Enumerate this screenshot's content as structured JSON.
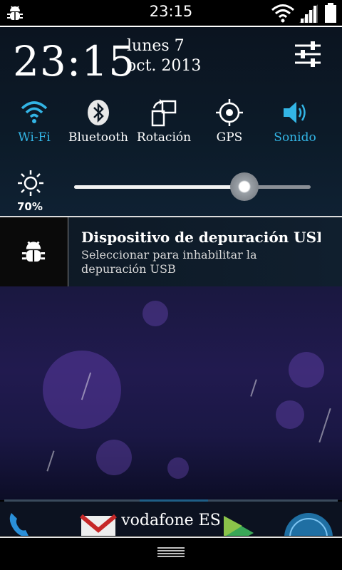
{
  "status_bar": {
    "time": "23:15",
    "icons": [
      "debug-bug-icon",
      "wifi-icon",
      "signal-icon",
      "battery-icon"
    ]
  },
  "header": {
    "clock": "23:15",
    "date_line1": "lunes 7",
    "date_line2": "oct. 2013",
    "settings_icon": "settings-sliders-icon"
  },
  "quick_settings": [
    {
      "label": "Wi-Fi",
      "icon": "wifi-icon",
      "active": true
    },
    {
      "label": "Bluetooth",
      "icon": "bluetooth-icon",
      "active": false
    },
    {
      "label": "Rotación",
      "icon": "rotation-icon",
      "active": false
    },
    {
      "label": "GPS",
      "icon": "gps-icon",
      "active": false
    },
    {
      "label": "Sonido",
      "icon": "sound-icon",
      "active": true
    }
  ],
  "brightness": {
    "percent_label": "70%",
    "level": 0.72,
    "icon": "brightness-icon"
  },
  "notification": {
    "title": "Dispositivo de depuración USB co",
    "text": "Seleccionar para inhabilitar la depuración USB",
    "icon": "debug-bug-icon"
  },
  "carrier": "vodafone ES",
  "colors": {
    "accent": "#33b5e5"
  }
}
